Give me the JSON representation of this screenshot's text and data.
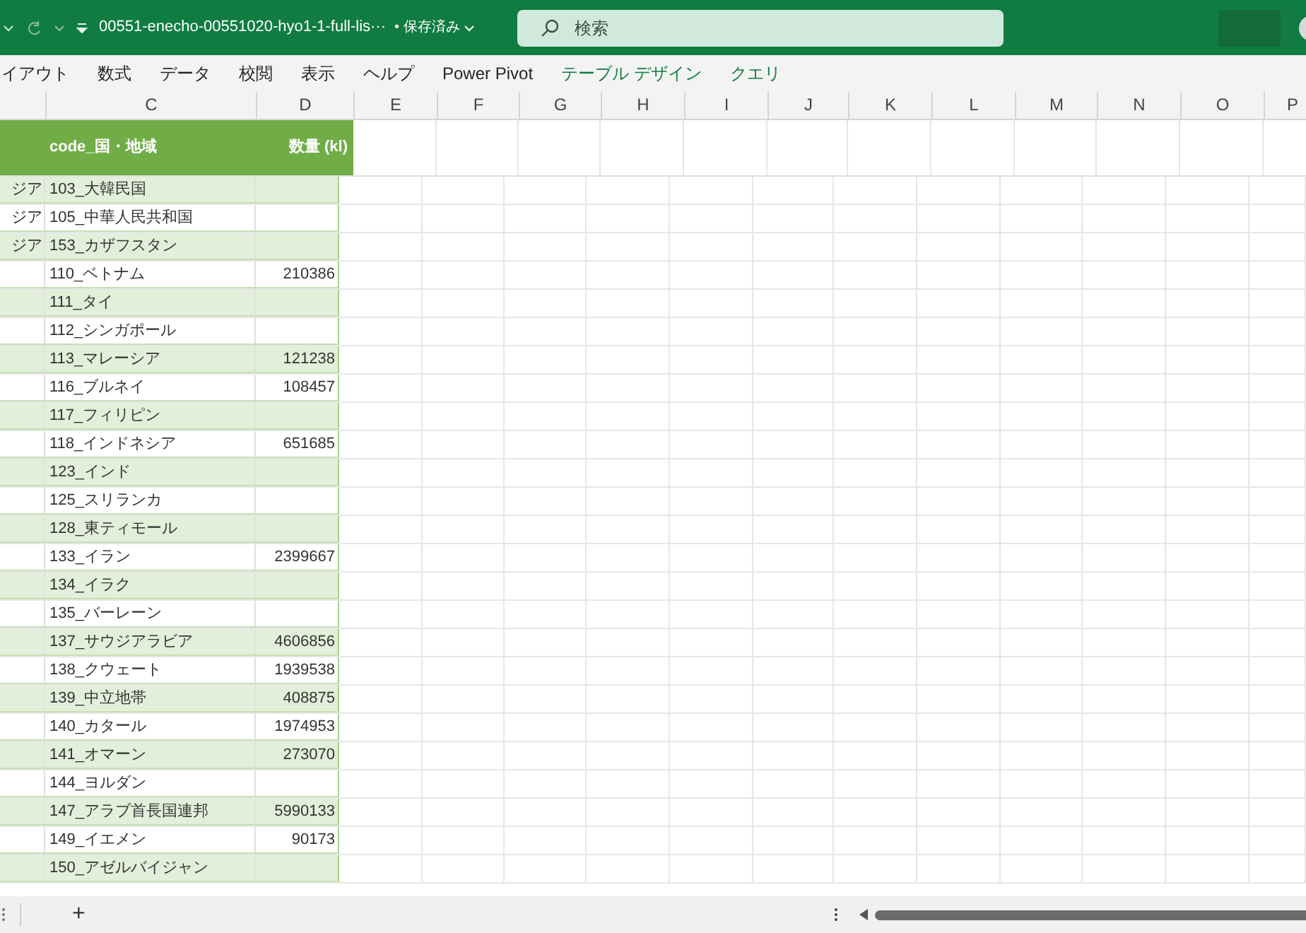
{
  "title_bar": {
    "file_name": "00551-enecho-00551020-hyo1-1-full-lis···",
    "save_status": "• 保存済み",
    "search": {
      "placeholder": "検索"
    }
  },
  "ribbon_tabs": [
    {
      "label": "イアウト",
      "kind": "normal"
    },
    {
      "label": "数式",
      "kind": "normal"
    },
    {
      "label": "データ",
      "kind": "normal"
    },
    {
      "label": "校閲",
      "kind": "normal"
    },
    {
      "label": "表示",
      "kind": "normal"
    },
    {
      "label": "ヘルプ",
      "kind": "normal"
    },
    {
      "label": "Power Pivot",
      "kind": "normal"
    },
    {
      "label": "テーブル デザイン",
      "kind": "contextual"
    },
    {
      "label": "クエリ",
      "kind": "contextual"
    }
  ],
  "column_headers": [
    "C",
    "D",
    "E",
    "F",
    "G",
    "H",
    "I",
    "J",
    "K",
    "L",
    "M",
    "N",
    "O",
    "P"
  ],
  "table": {
    "columns": [
      "code_国・地域",
      "数量 (kl)"
    ],
    "rows": [
      {
        "column_b": "ジア",
        "code": "103_大韓民国"
      },
      {
        "column_b": "ジア",
        "code": "105_中華人民共和国"
      },
      {
        "column_b": "ジア",
        "code": "153_カザフスタン"
      },
      {
        "code": "110_ベトナム",
        "quantity": "210386"
      },
      {
        "code": "111_タイ"
      },
      {
        "code": "112_シンガポール"
      },
      {
        "code": "113_マレーシア",
        "quantity": "121238"
      },
      {
        "code": "116_ブルネイ",
        "quantity": "108457"
      },
      {
        "code": "117_フィリピン"
      },
      {
        "code": "118_インドネシア",
        "quantity": "651685"
      },
      {
        "code": "123_インド"
      },
      {
        "code": "125_スリランカ"
      },
      {
        "code": "128_東ティモール"
      },
      {
        "code": "133_イラン",
        "quantity": "2399667"
      },
      {
        "code": "134_イラク"
      },
      {
        "code": "135_バーレーン"
      },
      {
        "code": "137_サウジアラビア",
        "quantity": "4606856"
      },
      {
        "code": "138_クウェート",
        "quantity": "1939538"
      },
      {
        "code": "139_中立地帯",
        "quantity": "408875"
      },
      {
        "code": "140_カタール",
        "quantity": "1974953"
      },
      {
        "code": "141_オマーン",
        "quantity": "273070"
      },
      {
        "code": "144_ヨルダン"
      },
      {
        "code": "147_アラブ首長国連邦",
        "quantity": "5990133"
      },
      {
        "code": "149_イエメン",
        "quantity": "90173"
      },
      {
        "code": "150_アゼルバイジャン"
      }
    ]
  },
  "sheet_bar": {
    "add_sheet": "+"
  }
}
